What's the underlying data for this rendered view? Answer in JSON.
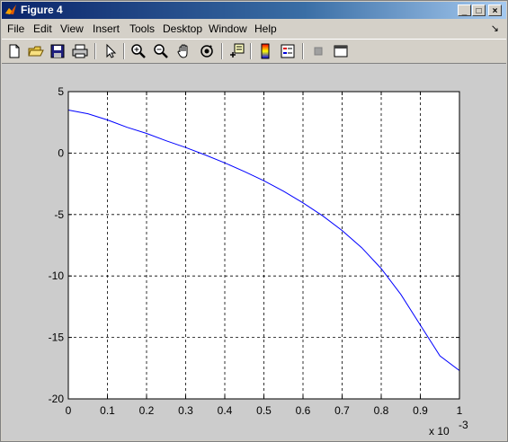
{
  "window": {
    "title": "Figure 4",
    "controls": {
      "minimize": "_",
      "maximize": "□",
      "close": "×"
    }
  },
  "menubar": {
    "items": [
      "File",
      "Edit",
      "View",
      "Insert",
      "Tools",
      "Desktop",
      "Window",
      "Help"
    ],
    "overflow_icon": "dock-arrow-icon"
  },
  "toolbar": {
    "buttons": [
      "new-figure-icon",
      "open-file-icon",
      "save-icon",
      "print-icon",
      "edit-plot-arrow-icon",
      "zoom-in-icon",
      "zoom-out-icon",
      "pan-hand-icon",
      "rotate-3d-icon",
      "data-cursor-icon",
      "colorbar-icon",
      "legend-icon",
      "hide-plot-tools-icon",
      "show-plot-tools-icon"
    ]
  },
  "chart_data": {
    "type": "line",
    "title": "",
    "xlabel": "",
    "ylabel": "",
    "x_exponent_label": {
      "base": "x 10",
      "exp": "-3"
    },
    "xlim": [
      0,
      1
    ],
    "ylim": [
      -20,
      5
    ],
    "xticks": [
      0,
      0.1,
      0.2,
      0.3,
      0.4,
      0.5,
      0.6,
      0.7,
      0.8,
      0.9,
      1
    ],
    "xtick_labels": [
      "0",
      "0.1",
      "0.2",
      "0.3",
      "0.4",
      "0.5",
      "0.6",
      "0.7",
      "0.8",
      "0.9",
      "1"
    ],
    "yticks": [
      5,
      0,
      -5,
      -10,
      -15,
      -20
    ],
    "ytick_labels": [
      "5",
      "0",
      "-5",
      "-10",
      "-15",
      "-20"
    ],
    "grid": true,
    "grid_style": "dashed",
    "series": [
      {
        "color": "#0000ff",
        "x": [
          0,
          0.05,
          0.1,
          0.15,
          0.2,
          0.25,
          0.3,
          0.35,
          0.4,
          0.45,
          0.5,
          0.55,
          0.6,
          0.65,
          0.7,
          0.75,
          0.8,
          0.85,
          0.9,
          0.95,
          1.0
        ],
        "y": [
          3.5,
          3.2,
          2.7,
          2.1,
          1.6,
          1.0,
          0.45,
          -0.15,
          -0.8,
          -1.5,
          -2.25,
          -3.1,
          -4.05,
          -5.1,
          -6.3,
          -7.7,
          -9.4,
          -11.5,
          -14.0,
          -16.5,
          -17.7
        ]
      }
    ]
  }
}
